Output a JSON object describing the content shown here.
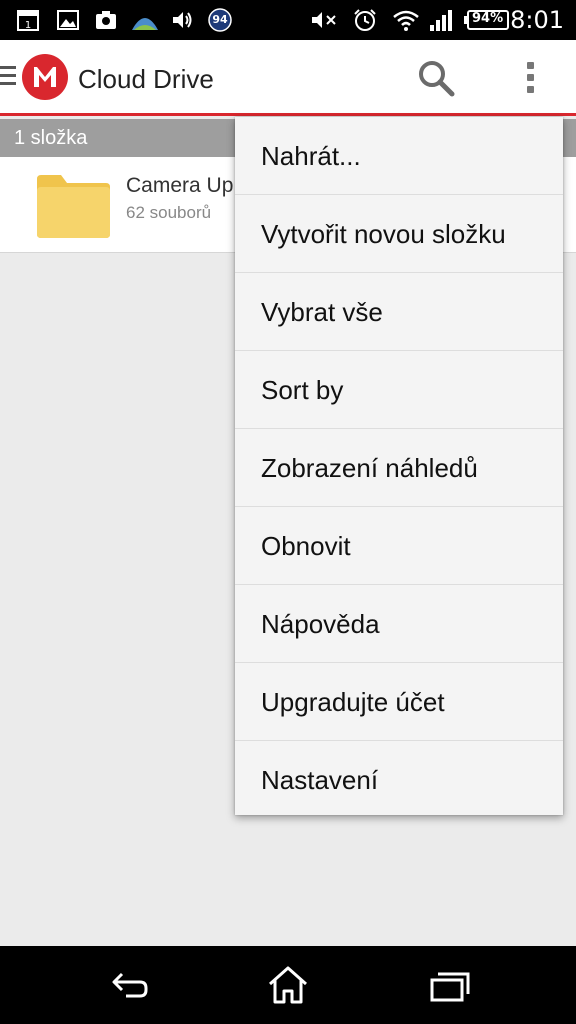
{
  "status_bar": {
    "time": "8:01",
    "battery_percent": "94%",
    "notification_badge": "94",
    "icons": [
      "calendar-icon",
      "image-icon",
      "camera-icon",
      "weather-icon",
      "volume-icon",
      "badge-icon",
      "mute-icon",
      "alarm-icon",
      "wifi-icon",
      "signal-icon",
      "battery-icon"
    ]
  },
  "app_bar": {
    "title": "Cloud Drive",
    "logo_letter": "M",
    "accent_color": "#d9272e"
  },
  "section": {
    "label": "1 složka"
  },
  "list": {
    "items": [
      {
        "name": "Camera Up",
        "meta": "62 souborů",
        "icon": "folder-icon"
      }
    ]
  },
  "menu": {
    "items": [
      {
        "label": "Nahrát..."
      },
      {
        "label": "Vytvořit novou složku"
      },
      {
        "label": "Vybrat vše"
      },
      {
        "label": "Sort by"
      },
      {
        "label": "Zobrazení náhledů"
      },
      {
        "label": "Obnovit"
      },
      {
        "label": "Nápověda"
      },
      {
        "label": "Upgradujte účet"
      },
      {
        "label": "Nastavení"
      }
    ]
  },
  "nav_bar": {
    "icons": [
      "back-icon",
      "home-icon",
      "recents-icon"
    ]
  }
}
